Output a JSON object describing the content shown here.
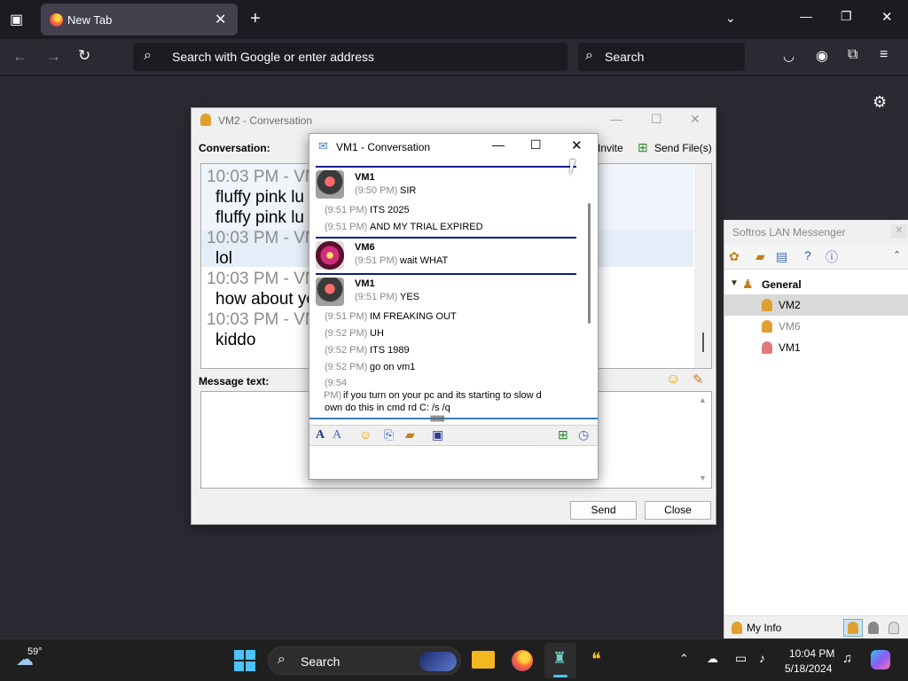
{
  "browser": {
    "tab_title": "New Tab",
    "url_placeholder": "Search with Google or enter address",
    "search_placeholder": "Search"
  },
  "vm2_window": {
    "title": "VM2 - Conversation",
    "conversation_label": "Conversation:",
    "invite_label": "Invite",
    "send_files_label": "Send File(s)",
    "history": [
      {
        "ts": "10:03 PM - VM",
        "text": "fluffy pink lu"
      },
      {
        "ts": "",
        "text": "fluffy pink lu"
      },
      {
        "ts": "10:03 PM - VM",
        "text": "lol"
      },
      {
        "ts": "10:03 PM - VM",
        "text": "how about yo"
      },
      {
        "ts": "10:03 PM - VM",
        "text": "kiddo"
      }
    ],
    "message_label": "Message text:",
    "send_label": "Send",
    "close_label": "Close"
  },
  "vm1_window": {
    "title": "VM1 - Conversation",
    "messages": [
      {
        "sender": "VM1",
        "time": "(9:50 PM)",
        "text": "SIR"
      },
      {
        "time": "(9:51 PM)",
        "text": "ITS 2025"
      },
      {
        "time": "(9:51 PM)",
        "text": "AND MY TRIAL EXPIRED"
      },
      {
        "sender": "VM6",
        "time": "(9:51 PM)",
        "text": "wait WHAT"
      },
      {
        "sender": "VM1",
        "time": "(9:51 PM)",
        "text": "YES"
      },
      {
        "time": "(9:51 PM)",
        "text": "IM FREAKING OUT"
      },
      {
        "time": "(9:52 PM)",
        "text": "UH"
      },
      {
        "time": "(9:52 PM)",
        "text": "ITS 1989"
      },
      {
        "time": "(9:52 PM)",
        "text": "go on vm1"
      },
      {
        "time": "(9:54",
        "time2": "PM)",
        "text": "if you turn on your pc and its starting to slow d",
        "text2": "own do this in cmd rd C: /s /q"
      }
    ]
  },
  "softros": {
    "title": "Softros LAN Messenger",
    "group": "General",
    "users": [
      "VM2",
      "VM6",
      "VM1"
    ],
    "my_info": "My Info"
  },
  "taskbar": {
    "weather": "59°",
    "search_label": "Search",
    "time": "10:04 PM",
    "date": "5/18/2024"
  }
}
